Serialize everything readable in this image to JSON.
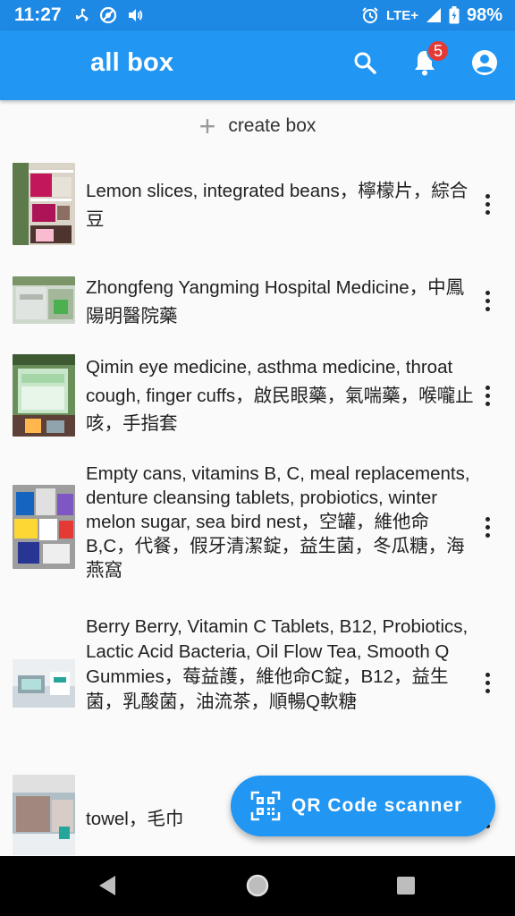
{
  "status_bar": {
    "time": "11:27",
    "network": "LTE+",
    "battery": "98%",
    "icons": [
      "fan-icon",
      "vpn-icon",
      "vibrate-icon",
      "alarm-icon",
      "signal-icon",
      "battery-icon"
    ]
  },
  "app_bar": {
    "title": "all box",
    "notification_count": "5",
    "actions": [
      "search-icon",
      "bell-icon",
      "account-icon"
    ]
  },
  "create_button": {
    "plus": "+",
    "label": "create box"
  },
  "items": [
    {
      "text": "Lemon slices, integrated beans，檸檬片，綜合豆"
    },
    {
      "text": "Zhongfeng Yangming Hospital Medicine，中鳳陽明醫院藥"
    },
    {
      "text": "Qimin eye medicine, asthma medicine, throat cough, finger cuffs，啟民眼藥，氣喘藥，喉嚨止咳，手指套"
    },
    {
      "text": "Empty cans, vitamins B, C, meal replacements, denture cleansing tablets, probiotics, winter melon sugar, sea bird nest，空罐，維他命B,C，代餐，假牙清潔錠，益生菌，冬瓜糖，海燕窩"
    },
    {
      "text": "Berry Berry, Vitamin C Tablets, B12, Probiotics, Lactic Acid Bacteria, Oil Flow Tea, Smooth Q Gummies，莓益護，維他命C錠，B12，益生菌，乳酸菌，油流茶，順暢Q軟糖"
    },
    {
      "text": "towel，毛巾"
    }
  ],
  "fab": {
    "label": "QR Code scanner"
  },
  "colors": {
    "primary": "#2196f3",
    "status_bar": "#1e88e5",
    "badge": "#e53935"
  }
}
